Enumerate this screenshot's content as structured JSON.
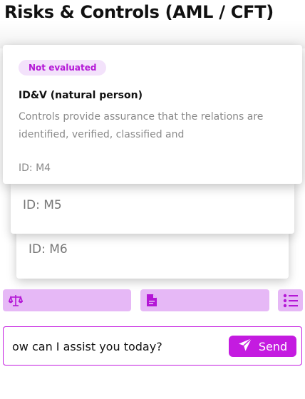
{
  "header": {
    "title": "Risks & Controls (AML / CFT)"
  },
  "cards": {
    "front": {
      "badge": "Not evaluated",
      "title": "ID&V (natural person)",
      "description": "Controls provide assurance that the relations are identified, verified, classified and",
      "id": "ID: M4"
    },
    "back1": {
      "id": "ID: M5"
    },
    "back2": {
      "id": "ID: M6"
    }
  },
  "toolbar": {
    "icons": [
      "scales-icon",
      "document-icon",
      "list-icon"
    ]
  },
  "chat": {
    "input_value": "ow can I assist you today?",
    "send_label": "Send"
  },
  "colors": {
    "accent": "#c41be0",
    "accent_light": "#e6b8f6",
    "badge_bg": "#f3e2fb"
  }
}
